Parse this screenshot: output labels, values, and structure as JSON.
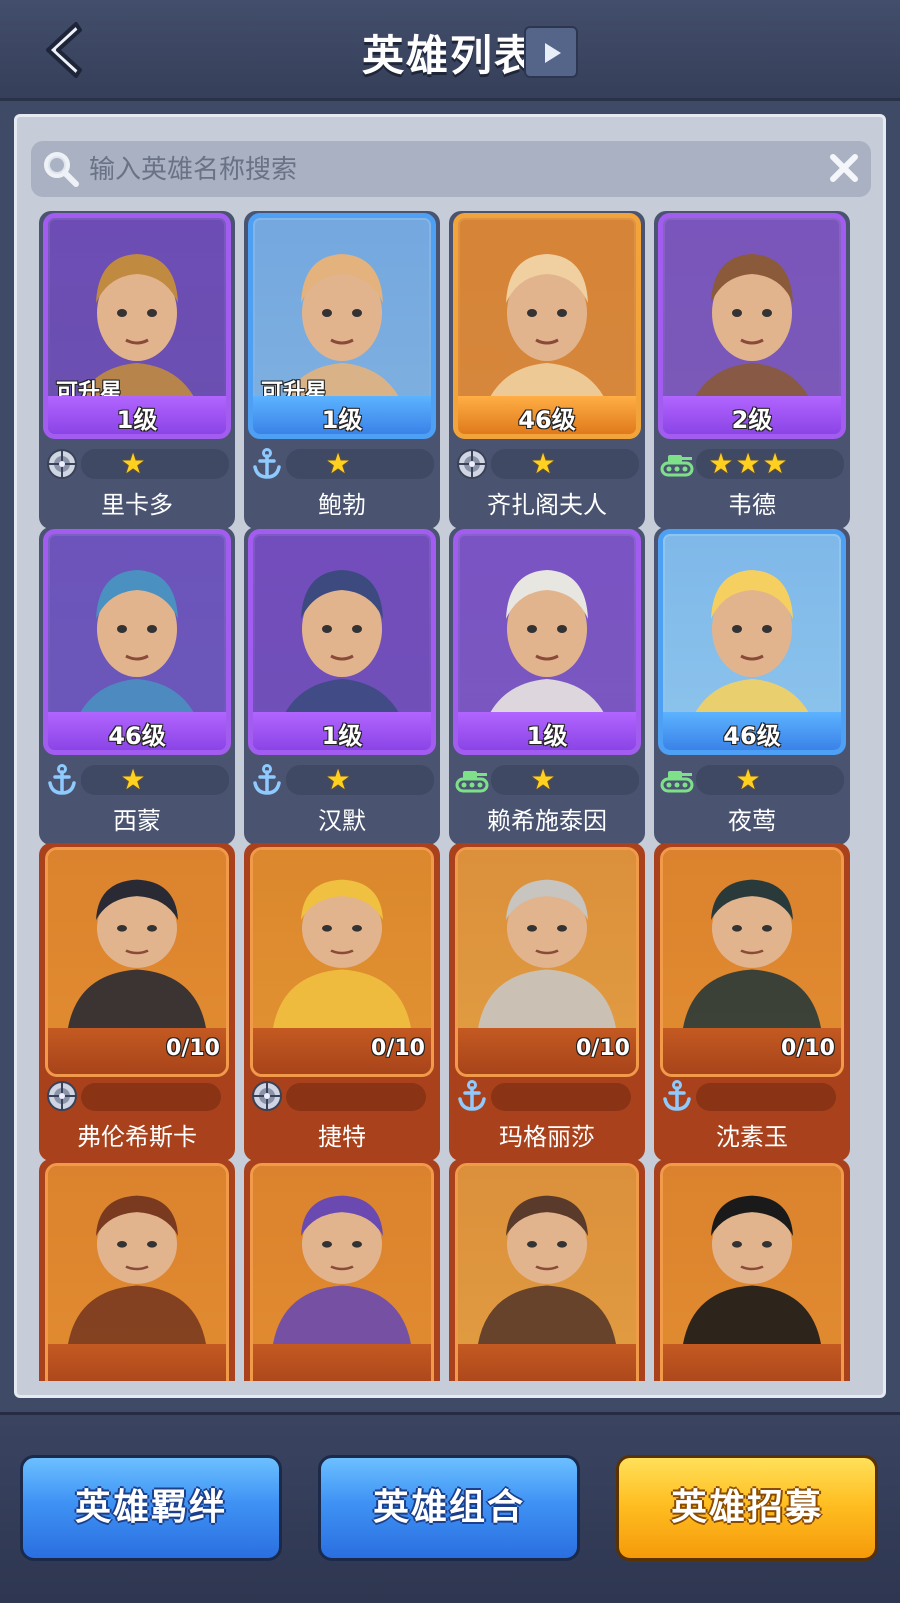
{
  "header": {
    "title": "英雄列表"
  },
  "search": {
    "placeholder": "输入英雄名称搜索"
  },
  "heroes": [
    {
      "name": "里卡多",
      "level": "1级",
      "rarity": "purple",
      "upgradable": "可升星",
      "stars": "★",
      "class": "radar-icon",
      "colors": [
        "#6a50b0",
        "#c08a40"
      ]
    },
    {
      "name": "鲍勃",
      "level": "1级",
      "rarity": "blue",
      "upgradable": "可升星",
      "stars": "★",
      "class": "anchor-icon",
      "colors": [
        "#7fb0e0",
        "#e3b27d"
      ]
    },
    {
      "name": "齐扎阁夫人",
      "level": "46级",
      "rarity": "orange",
      "upgradable": "",
      "stars": "★",
      "class": "radar-icon",
      "colors": [
        "#d7883c",
        "#f0d0a0"
      ]
    },
    {
      "name": "韦德",
      "level": "2级",
      "rarity": "purple",
      "upgradable": "",
      "stars": "★★★",
      "class": "tank-icon",
      "colors": [
        "#7a5ab8",
        "#8a5a3a"
      ]
    },
    {
      "name": "西蒙",
      "level": "46级",
      "rarity": "purple",
      "upgradable": "",
      "stars": "★",
      "class": "anchor-icon",
      "colors": [
        "#6a58b8",
        "#4a90c0"
      ]
    },
    {
      "name": "汉默",
      "level": "1级",
      "rarity": "purple",
      "upgradable": "",
      "stars": "★",
      "class": "anchor-icon",
      "colors": [
        "#7050b8",
        "#3c4a80"
      ]
    },
    {
      "name": "赖希施泰因",
      "level": "1级",
      "rarity": "purple",
      "upgradable": "",
      "stars": "★",
      "class": "tank-icon",
      "colors": [
        "#7a58c0",
        "#e8e6e0"
      ]
    },
    {
      "name": "夜莺",
      "level": "46级",
      "rarity": "blue",
      "upgradable": "",
      "stars": "★",
      "class": "tank-icon",
      "colors": [
        "#8cc4ec",
        "#f5d060"
      ]
    },
    {
      "name": "弗伦希斯卡",
      "fragments": "0/10",
      "class": "radar-icon",
      "colors": [
        "#e08a30",
        "#2a2a34"
      ]
    },
    {
      "name": "捷特",
      "fragments": "0/10",
      "class": "radar-icon",
      "colors": [
        "#e09030",
        "#f0c040"
      ]
    },
    {
      "name": "玛格丽莎",
      "fragments": "0/10",
      "class": "anchor-icon",
      "colors": [
        "#e09a40",
        "#c8c4c0"
      ]
    },
    {
      "name": "沈素玉",
      "fragments": "0/10",
      "class": "anchor-icon",
      "colors": [
        "#e08a30",
        "#2a3a3a"
      ]
    },
    {
      "name": "",
      "fragments": "",
      "class": "",
      "colors": [
        "#e08a30",
        "#7a3a20"
      ]
    },
    {
      "name": "",
      "fragments": "",
      "class": "",
      "colors": [
        "#e08a30",
        "#6a4ab0"
      ]
    },
    {
      "name": "",
      "fragments": "",
      "class": "",
      "colors": [
        "#e09a40",
        "#5a3a2a"
      ]
    },
    {
      "name": "",
      "fragments": "",
      "class": "",
      "colors": [
        "#e08a30",
        "#1a1a1a"
      ]
    }
  ],
  "bottom_buttons": {
    "bond": "英雄羁绊",
    "combo": "英雄组合",
    "recruit": "英雄招募"
  },
  "colors": {
    "accent_blue": "#3f92f4",
    "accent_gold": "#ffbf22",
    "bg": "#3f4a66"
  }
}
